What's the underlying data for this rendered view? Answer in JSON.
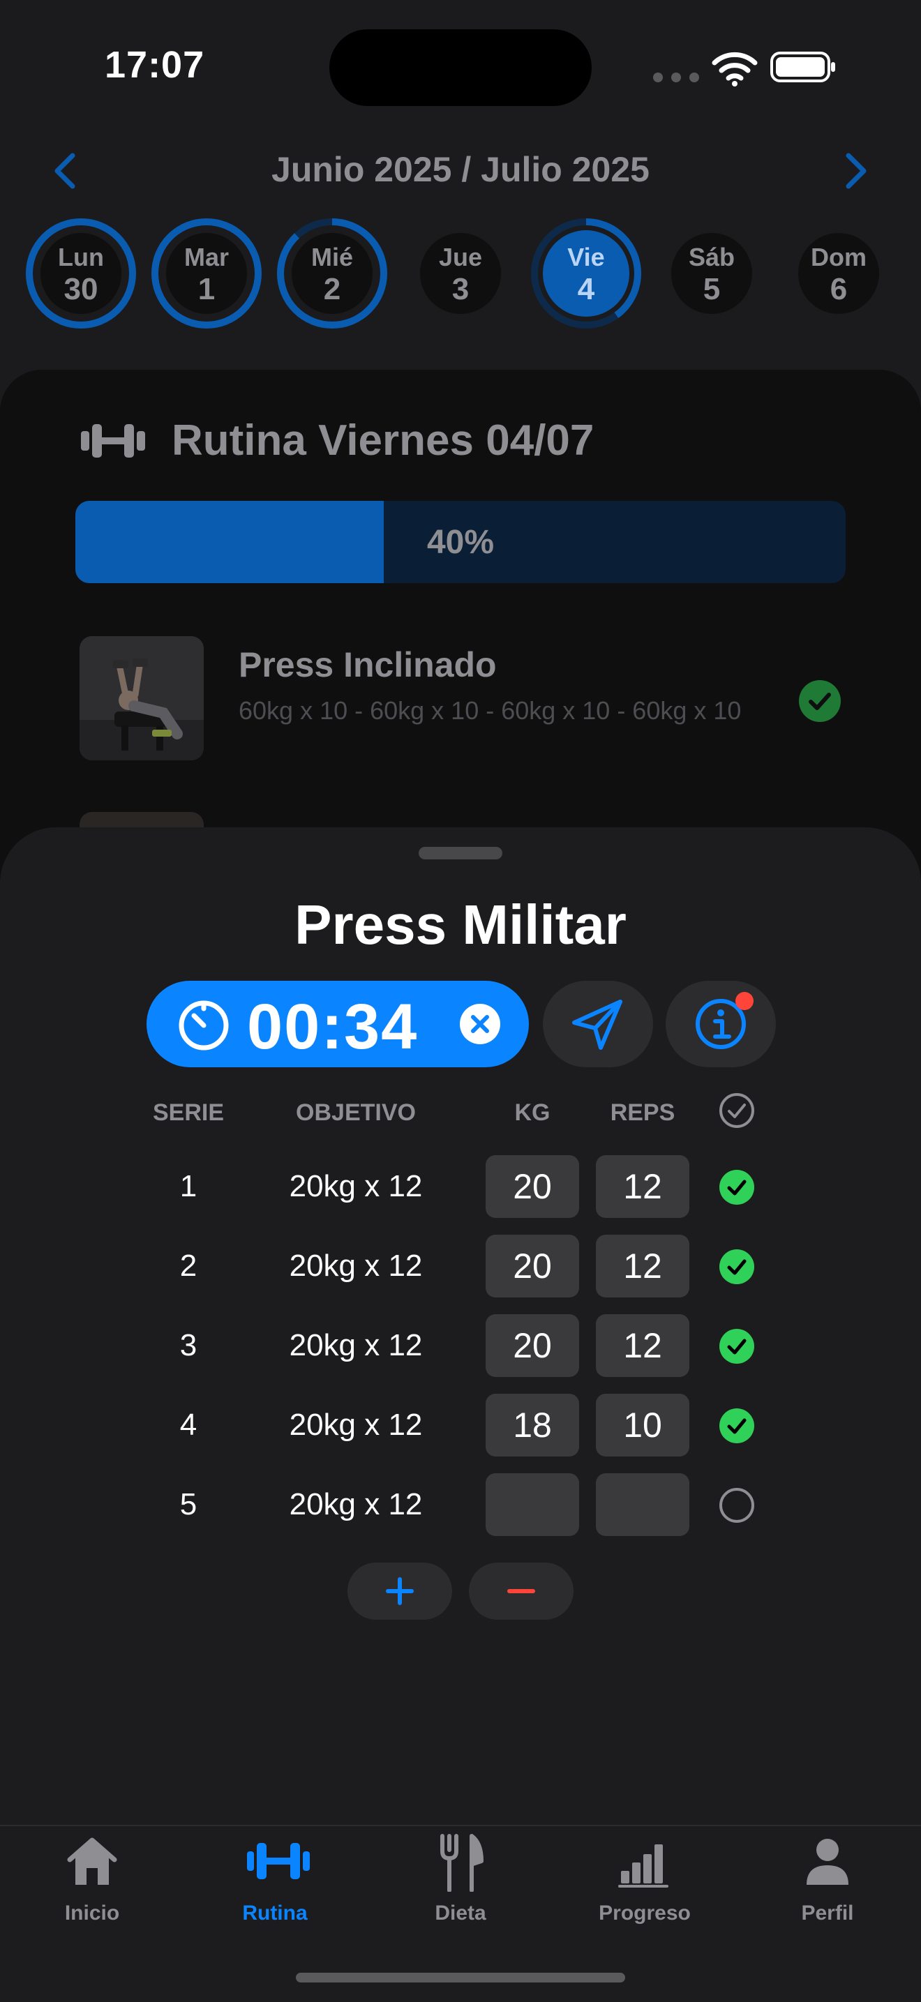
{
  "status_bar": {
    "time": "17:07"
  },
  "header": {
    "month_title": "Junio 2025 / Julio 2025"
  },
  "days": [
    {
      "name": "Lun",
      "num": "30",
      "progress": 1.0,
      "selected": false
    },
    {
      "name": "Mar",
      "num": "1",
      "progress": 1.0,
      "selected": false
    },
    {
      "name": "Mié",
      "num": "2",
      "progress": 0.88,
      "selected": false
    },
    {
      "name": "Jue",
      "num": "3",
      "progress": 0.0,
      "selected": false
    },
    {
      "name": "Vie",
      "num": "4",
      "progress": 0.4,
      "selected": true
    },
    {
      "name": "Sáb",
      "num": "5",
      "progress": 0.0,
      "selected": false
    },
    {
      "name": "Dom",
      "num": "6",
      "progress": 0.0,
      "selected": false
    }
  ],
  "routine": {
    "title": "Rutina Viernes 04/07",
    "progress_label": "40%",
    "progress_value": 0.4,
    "exercise": {
      "name": "Press Inclinado",
      "detail": "60kg x 10 - 60kg x 10 - 60kg x 10 - 60kg x 10",
      "completed": true
    }
  },
  "sheet": {
    "title": "Press Militar",
    "timer": "00:34",
    "columns": {
      "serie": "SERIE",
      "objetivo": "OBJETIVO",
      "kg": "KG",
      "reps": "REPS"
    },
    "sets": [
      {
        "serie": "1",
        "objetivo": "20kg x 12",
        "kg": "20",
        "reps": "12",
        "done": true
      },
      {
        "serie": "2",
        "objetivo": "20kg x 12",
        "kg": "20",
        "reps": "12",
        "done": true
      },
      {
        "serie": "3",
        "objetivo": "20kg x 12",
        "kg": "20",
        "reps": "12",
        "done": true
      },
      {
        "serie": "4",
        "objetivo": "20kg x 12",
        "kg": "18",
        "reps": "10",
        "done": true
      },
      {
        "serie": "5",
        "objetivo": "20kg x 12",
        "kg": "",
        "reps": "",
        "done": false
      }
    ],
    "add_label": "+",
    "remove_label": "−"
  },
  "tabs": [
    {
      "label": "Inicio",
      "icon": "house-icon",
      "active": false
    },
    {
      "label": "Rutina",
      "icon": "dumbbell-icon",
      "active": true
    },
    {
      "label": "Dieta",
      "icon": "fork-knife-icon",
      "active": false
    },
    {
      "label": "Progreso",
      "icon": "chart-bar-icon",
      "active": false
    },
    {
      "label": "Perfil",
      "icon": "person-icon",
      "active": false
    }
  ],
  "colors": {
    "accent": "#0a84ff",
    "accent_dark": "#0a5cb1",
    "success": "#30d158",
    "destructive": "#ff453a",
    "background": "#1b1b1d"
  }
}
